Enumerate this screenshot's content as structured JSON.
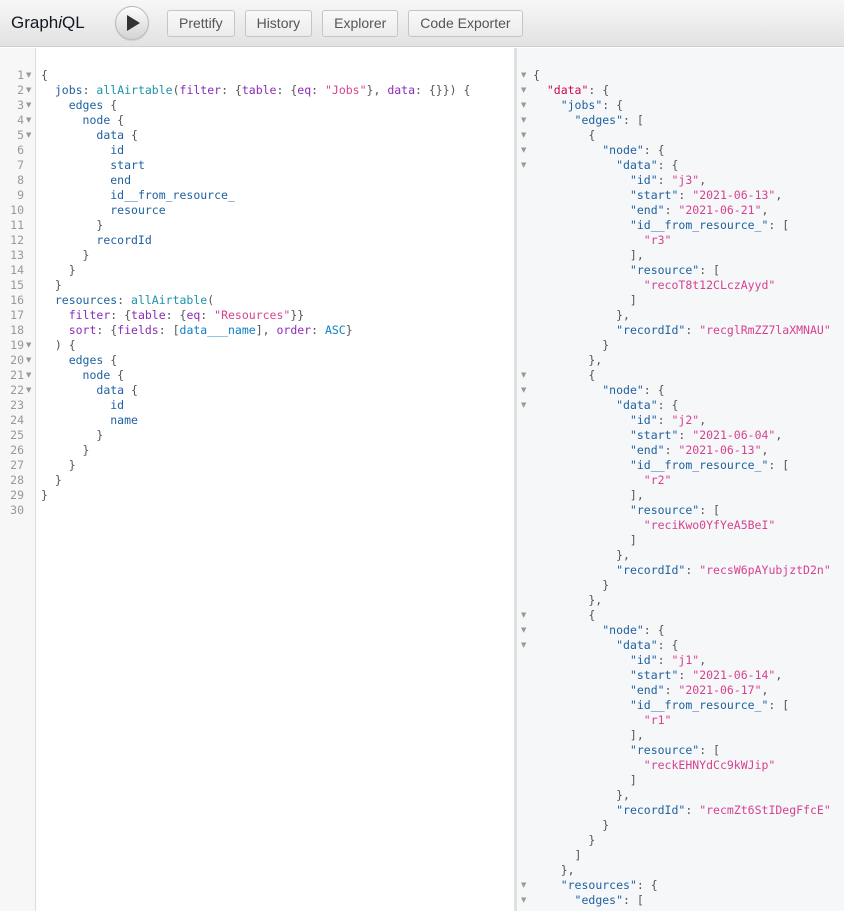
{
  "header": {
    "title_prefix": "Graph",
    "title_i": "i",
    "title_suffix": "QL",
    "run_label": "Execute Query",
    "buttons": [
      "Prettify",
      "History",
      "Explorer",
      "Code Exporter"
    ]
  },
  "query_editor": {
    "fold_lines": [
      1,
      2,
      3,
      4,
      5,
      19,
      20,
      21,
      22
    ],
    "line_count": 30,
    "lines": [
      [
        [
          "p",
          "{"
        ]
      ],
      [
        [
          "p",
          "  "
        ],
        [
          "f",
          "jobs"
        ],
        [
          "p",
          ": "
        ],
        [
          "q",
          "allAirtable"
        ],
        [
          "p",
          "("
        ],
        [
          "a",
          "filter"
        ],
        [
          "p",
          ": {"
        ],
        [
          "a",
          "table"
        ],
        [
          "p",
          ": {"
        ],
        [
          "a",
          "eq"
        ],
        [
          "p",
          ": "
        ],
        [
          "s",
          "\"Jobs\""
        ],
        [
          "p",
          "}, "
        ],
        [
          "a",
          "data"
        ],
        [
          "p",
          ": {}}) {"
        ]
      ],
      [
        [
          "p",
          "    "
        ],
        [
          "f",
          "edges"
        ],
        [
          "p",
          " {"
        ]
      ],
      [
        [
          "p",
          "      "
        ],
        [
          "f",
          "node"
        ],
        [
          "p",
          " {"
        ]
      ],
      [
        [
          "p",
          "        "
        ],
        [
          "f",
          "data"
        ],
        [
          "p",
          " {"
        ]
      ],
      [
        [
          "p",
          "          "
        ],
        [
          "f",
          "id"
        ]
      ],
      [
        [
          "p",
          "          "
        ],
        [
          "f",
          "start"
        ]
      ],
      [
        [
          "p",
          "          "
        ],
        [
          "f",
          "end"
        ]
      ],
      [
        [
          "p",
          "          "
        ],
        [
          "f",
          "id__from_resource_"
        ]
      ],
      [
        [
          "p",
          "          "
        ],
        [
          "f",
          "resource"
        ]
      ],
      [
        [
          "p",
          "        }"
        ]
      ],
      [
        [
          "p",
          "        "
        ],
        [
          "f",
          "recordId"
        ]
      ],
      [
        [
          "p",
          "      }"
        ]
      ],
      [
        [
          "p",
          "    }"
        ]
      ],
      [
        [
          "p",
          "  }"
        ]
      ],
      [
        [
          "p",
          "  "
        ],
        [
          "f",
          "resources"
        ],
        [
          "p",
          ": "
        ],
        [
          "q",
          "allAirtable"
        ],
        [
          "p",
          "("
        ]
      ],
      [
        [
          "p",
          "    "
        ],
        [
          "a",
          "filter"
        ],
        [
          "p",
          ": {"
        ],
        [
          "a",
          "table"
        ],
        [
          "p",
          ": {"
        ],
        [
          "a",
          "eq"
        ],
        [
          "p",
          ": "
        ],
        [
          "s",
          "\"Resources\""
        ],
        [
          "p",
          "}}"
        ]
      ],
      [
        [
          "p",
          "    "
        ],
        [
          "a",
          "sort"
        ],
        [
          "p",
          ": {"
        ],
        [
          "a",
          "fields"
        ],
        [
          "p",
          ": ["
        ],
        [
          "e",
          "data___name"
        ],
        [
          "p",
          "], "
        ],
        [
          "a",
          "order"
        ],
        [
          "p",
          ": "
        ],
        [
          "e",
          "ASC"
        ],
        [
          "p",
          "}"
        ]
      ],
      [
        [
          "p",
          "  ) {"
        ]
      ],
      [
        [
          "p",
          "    "
        ],
        [
          "f",
          "edges"
        ],
        [
          "p",
          " {"
        ]
      ],
      [
        [
          "p",
          "      "
        ],
        [
          "f",
          "node"
        ],
        [
          "p",
          " {"
        ]
      ],
      [
        [
          "p",
          "        "
        ],
        [
          "f",
          "data"
        ],
        [
          "p",
          " {"
        ]
      ],
      [
        [
          "p",
          "          "
        ],
        [
          "f",
          "id"
        ]
      ],
      [
        [
          "p",
          "          "
        ],
        [
          "f",
          "name"
        ]
      ],
      [
        [
          "p",
          "        }"
        ]
      ],
      [
        [
          "p",
          "      }"
        ]
      ],
      [
        [
          "p",
          "    }"
        ]
      ],
      [
        [
          "p",
          "  }"
        ]
      ],
      [
        [
          "p",
          "}"
        ]
      ],
      [
        [
          "p",
          ""
        ]
      ]
    ]
  },
  "result_viewer": {
    "fold_lines": [
      1,
      2,
      3,
      4,
      5,
      6,
      7,
      21,
      22,
      23,
      37,
      38,
      39,
      55,
      56
    ],
    "lines": [
      [
        [
          "p",
          "{"
        ]
      ],
      [
        [
          "p",
          "  "
        ],
        [
          "d",
          "\"data\""
        ],
        [
          "p",
          ": {"
        ]
      ],
      [
        [
          "p",
          "    "
        ],
        [
          "f",
          "\"jobs\""
        ],
        [
          "p",
          ": {"
        ]
      ],
      [
        [
          "p",
          "      "
        ],
        [
          "f",
          "\"edges\""
        ],
        [
          "p",
          ": ["
        ]
      ],
      [
        [
          "p",
          "        {"
        ]
      ],
      [
        [
          "p",
          "          "
        ],
        [
          "f",
          "\"node\""
        ],
        [
          "p",
          ": {"
        ]
      ],
      [
        [
          "p",
          "            "
        ],
        [
          "f",
          "\"data\""
        ],
        [
          "p",
          ": {"
        ]
      ],
      [
        [
          "p",
          "              "
        ],
        [
          "f",
          "\"id\""
        ],
        [
          "p",
          ": "
        ],
        [
          "s",
          "\"j3\""
        ],
        [
          "p",
          ","
        ]
      ],
      [
        [
          "p",
          "              "
        ],
        [
          "f",
          "\"start\""
        ],
        [
          "p",
          ": "
        ],
        [
          "s",
          "\"2021-06-13\""
        ],
        [
          "p",
          ","
        ]
      ],
      [
        [
          "p",
          "              "
        ],
        [
          "f",
          "\"end\""
        ],
        [
          "p",
          ": "
        ],
        [
          "s",
          "\"2021-06-21\""
        ],
        [
          "p",
          ","
        ]
      ],
      [
        [
          "p",
          "              "
        ],
        [
          "f",
          "\"id__from_resource_\""
        ],
        [
          "p",
          ": ["
        ]
      ],
      [
        [
          "p",
          "                "
        ],
        [
          "s",
          "\"r3\""
        ]
      ],
      [
        [
          "p",
          "              ],"
        ]
      ],
      [
        [
          "p",
          "              "
        ],
        [
          "f",
          "\"resource\""
        ],
        [
          "p",
          ": ["
        ]
      ],
      [
        [
          "p",
          "                "
        ],
        [
          "s",
          "\"recoT8t12CLczAyyd\""
        ]
      ],
      [
        [
          "p",
          "              ]"
        ]
      ],
      [
        [
          "p",
          "            },"
        ]
      ],
      [
        [
          "p",
          "            "
        ],
        [
          "f",
          "\"recordId\""
        ],
        [
          "p",
          ": "
        ],
        [
          "s",
          "\"recglRmZZ7laXMNAU\""
        ]
      ],
      [
        [
          "p",
          "          }"
        ]
      ],
      [
        [
          "p",
          "        },"
        ]
      ],
      [
        [
          "p",
          "        {"
        ]
      ],
      [
        [
          "p",
          "          "
        ],
        [
          "f",
          "\"node\""
        ],
        [
          "p",
          ": {"
        ]
      ],
      [
        [
          "p",
          "            "
        ],
        [
          "f",
          "\"data\""
        ],
        [
          "p",
          ": {"
        ]
      ],
      [
        [
          "p",
          "              "
        ],
        [
          "f",
          "\"id\""
        ],
        [
          "p",
          ": "
        ],
        [
          "s",
          "\"j2\""
        ],
        [
          "p",
          ","
        ]
      ],
      [
        [
          "p",
          "              "
        ],
        [
          "f",
          "\"start\""
        ],
        [
          "p",
          ": "
        ],
        [
          "s",
          "\"2021-06-04\""
        ],
        [
          "p",
          ","
        ]
      ],
      [
        [
          "p",
          "              "
        ],
        [
          "f",
          "\"end\""
        ],
        [
          "p",
          ": "
        ],
        [
          "s",
          "\"2021-06-13\""
        ],
        [
          "p",
          ","
        ]
      ],
      [
        [
          "p",
          "              "
        ],
        [
          "f",
          "\"id__from_resource_\""
        ],
        [
          "p",
          ": ["
        ]
      ],
      [
        [
          "p",
          "                "
        ],
        [
          "s",
          "\"r2\""
        ]
      ],
      [
        [
          "p",
          "              ],"
        ]
      ],
      [
        [
          "p",
          "              "
        ],
        [
          "f",
          "\"resource\""
        ],
        [
          "p",
          ": ["
        ]
      ],
      [
        [
          "p",
          "                "
        ],
        [
          "s",
          "\"reciKwo0YfYeA5BeI\""
        ]
      ],
      [
        [
          "p",
          "              ]"
        ]
      ],
      [
        [
          "p",
          "            },"
        ]
      ],
      [
        [
          "p",
          "            "
        ],
        [
          "f",
          "\"recordId\""
        ],
        [
          "p",
          ": "
        ],
        [
          "s",
          "\"recsW6pAYubjztD2n\""
        ]
      ],
      [
        [
          "p",
          "          }"
        ]
      ],
      [
        [
          "p",
          "        },"
        ]
      ],
      [
        [
          "p",
          "        {"
        ]
      ],
      [
        [
          "p",
          "          "
        ],
        [
          "f",
          "\"node\""
        ],
        [
          "p",
          ": {"
        ]
      ],
      [
        [
          "p",
          "            "
        ],
        [
          "f",
          "\"data\""
        ],
        [
          "p",
          ": {"
        ]
      ],
      [
        [
          "p",
          "              "
        ],
        [
          "f",
          "\"id\""
        ],
        [
          "p",
          ": "
        ],
        [
          "s",
          "\"j1\""
        ],
        [
          "p",
          ","
        ]
      ],
      [
        [
          "p",
          "              "
        ],
        [
          "f",
          "\"start\""
        ],
        [
          "p",
          ": "
        ],
        [
          "s",
          "\"2021-06-14\""
        ],
        [
          "p",
          ","
        ]
      ],
      [
        [
          "p",
          "              "
        ],
        [
          "f",
          "\"end\""
        ],
        [
          "p",
          ": "
        ],
        [
          "s",
          "\"2021-06-17\""
        ],
        [
          "p",
          ","
        ]
      ],
      [
        [
          "p",
          "              "
        ],
        [
          "f",
          "\"id__from_resource_\""
        ],
        [
          "p",
          ": ["
        ]
      ],
      [
        [
          "p",
          "                "
        ],
        [
          "s",
          "\"r1\""
        ]
      ],
      [
        [
          "p",
          "              ],"
        ]
      ],
      [
        [
          "p",
          "              "
        ],
        [
          "f",
          "\"resource\""
        ],
        [
          "p",
          ": ["
        ]
      ],
      [
        [
          "p",
          "                "
        ],
        [
          "s",
          "\"reckEHNYdCc9kWJip\""
        ]
      ],
      [
        [
          "p",
          "              ]"
        ]
      ],
      [
        [
          "p",
          "            },"
        ]
      ],
      [
        [
          "p",
          "            "
        ],
        [
          "f",
          "\"recordId\""
        ],
        [
          "p",
          ": "
        ],
        [
          "s",
          "\"recmZt6StIDegFfcE\""
        ]
      ],
      [
        [
          "p",
          "          }"
        ]
      ],
      [
        [
          "p",
          "        }"
        ]
      ],
      [
        [
          "p",
          "      ]"
        ]
      ],
      [
        [
          "p",
          "    },"
        ]
      ],
      [
        [
          "p",
          "    "
        ],
        [
          "f",
          "\"resources\""
        ],
        [
          "p",
          ": {"
        ]
      ],
      [
        [
          "p",
          "      "
        ],
        [
          "f",
          "\"edges\""
        ],
        [
          "p",
          ": ["
        ]
      ]
    ]
  }
}
